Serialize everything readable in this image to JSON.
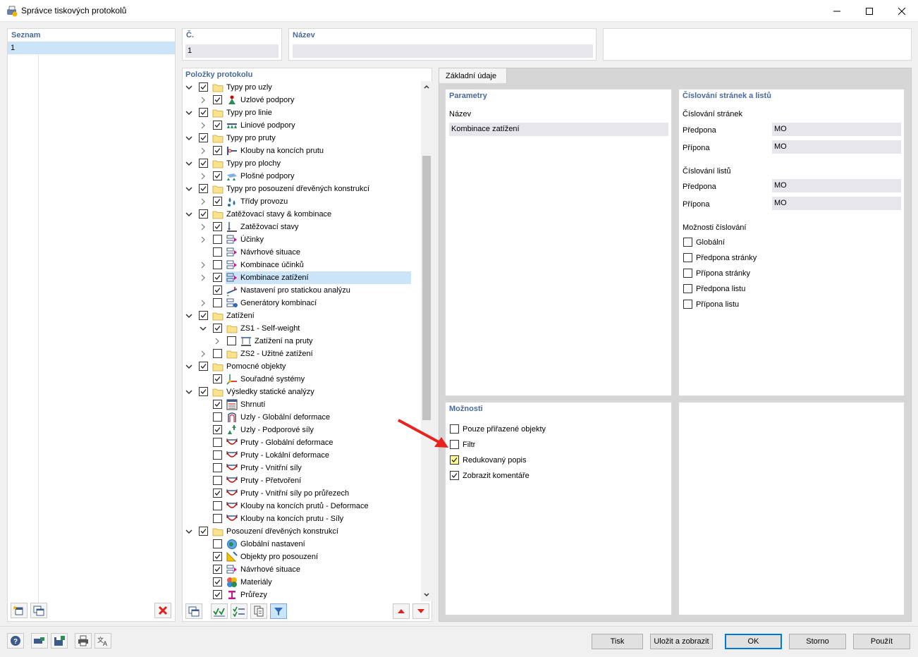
{
  "window": {
    "title": "Správce tiskových protokolů"
  },
  "list_panel": {
    "header": "Seznam",
    "rows": [
      "1"
    ]
  },
  "number_field": {
    "label": "Č.",
    "value": "1"
  },
  "name_field": {
    "label": "Název",
    "value": ""
  },
  "tree": {
    "header": "Položky protokolu",
    "items": [
      {
        "label": "Typy pro uzly",
        "level": 0,
        "expand": "open",
        "checked": true,
        "icon": "folder-icon"
      },
      {
        "label": "Uzlové podpory",
        "level": 1,
        "expand": "closed",
        "checked": true,
        "icon": "nodal-support-icon"
      },
      {
        "label": "Typy pro linie",
        "level": 0,
        "expand": "open",
        "checked": true,
        "icon": "folder-icon"
      },
      {
        "label": "Liniové podpory",
        "level": 1,
        "expand": "closed",
        "checked": true,
        "icon": "line-support-icon"
      },
      {
        "label": "Typy pro pruty",
        "level": 0,
        "expand": "open",
        "checked": true,
        "icon": "folder-icon"
      },
      {
        "label": "Klouby na koncích prutu",
        "level": 1,
        "expand": "closed",
        "checked": true,
        "icon": "member-hinge-icon"
      },
      {
        "label": "Typy pro plochy",
        "level": 0,
        "expand": "open",
        "checked": true,
        "icon": "folder-icon"
      },
      {
        "label": "Plošné podpory",
        "level": 1,
        "expand": "closed",
        "checked": true,
        "icon": "surface-support-icon"
      },
      {
        "label": "Typy pro posouzení dřevěných konstrukcí",
        "level": 0,
        "expand": "open",
        "checked": true,
        "icon": "folder-icon"
      },
      {
        "label": "Třídy provozu",
        "level": 1,
        "expand": "closed",
        "checked": true,
        "icon": "service-class-icon"
      },
      {
        "label": "Zatěžovací stavy & kombinace",
        "level": 0,
        "expand": "open",
        "checked": true,
        "icon": "folder-icon"
      },
      {
        "label": "Zatěžovací stavy",
        "level": 1,
        "expand": "closed",
        "checked": true,
        "icon": "load-case-icon"
      },
      {
        "label": "Účinky",
        "level": 1,
        "expand": "closed",
        "checked": false,
        "icon": "action-icon"
      },
      {
        "label": "Návrhové situace",
        "level": 1,
        "expand": "none",
        "checked": false,
        "icon": "design-situation-icon"
      },
      {
        "label": "Kombinace účinků",
        "level": 1,
        "expand": "closed",
        "checked": false,
        "icon": "action-combination-icon"
      },
      {
        "label": "Kombinace zatížení",
        "level": 1,
        "expand": "closed",
        "checked": true,
        "icon": "load-combination-icon",
        "selected": true
      },
      {
        "label": "Nastavení pro statickou analýzu",
        "level": 1,
        "expand": "none",
        "checked": true,
        "icon": "static-analysis-settings-icon"
      },
      {
        "label": "Generátory kombinací",
        "level": 1,
        "expand": "closed",
        "checked": false,
        "icon": "combination-wizard-icon"
      },
      {
        "label": "Zatížení",
        "level": 0,
        "expand": "open",
        "checked": true,
        "icon": "folder-icon"
      },
      {
        "label": "ZS1 - Self-weight",
        "level": 1,
        "expand": "open",
        "checked": true,
        "icon": "folder-icon"
      },
      {
        "label": "Zatížení na pruty",
        "level": 2,
        "expand": "closed",
        "checked": false,
        "icon": "member-load-icon"
      },
      {
        "label": "ZS2 - Užitné zatížení",
        "level": 1,
        "expand": "closed",
        "checked": false,
        "icon": "folder-icon"
      },
      {
        "label": "Pomocné objekty",
        "level": 0,
        "expand": "open",
        "checked": true,
        "icon": "folder-icon"
      },
      {
        "label": "Souřadné systémy",
        "level": 1,
        "expand": "none",
        "checked": true,
        "icon": "coordinate-system-icon"
      },
      {
        "label": "Výsledky statické analýzy",
        "level": 0,
        "expand": "open",
        "checked": true,
        "icon": "folder-icon"
      },
      {
        "label": "Shrnutí",
        "level": 1,
        "expand": "none",
        "checked": true,
        "icon": "summary-icon"
      },
      {
        "label": "Uzly - Globální deformace",
        "level": 1,
        "expand": "none",
        "checked": false,
        "icon": "node-deformation-icon"
      },
      {
        "label": "Uzly - Podporové síly",
        "level": 1,
        "expand": "none",
        "checked": true,
        "icon": "support-forces-icon"
      },
      {
        "label": "Pruty - Globální deformace",
        "level": 1,
        "expand": "none",
        "checked": false,
        "icon": "member-result-icon"
      },
      {
        "label": "Pruty - Lokální deformace",
        "level": 1,
        "expand": "none",
        "checked": false,
        "icon": "member-result-icon"
      },
      {
        "label": "Pruty - Vnitřní síly",
        "level": 1,
        "expand": "none",
        "checked": false,
        "icon": "member-result-icon"
      },
      {
        "label": "Pruty - Přetvoření",
        "level": 1,
        "expand": "none",
        "checked": false,
        "icon": "member-result-icon"
      },
      {
        "label": "Pruty - Vnitřní síly po průřezech",
        "level": 1,
        "expand": "none",
        "checked": true,
        "icon": "member-result-icon"
      },
      {
        "label": "Klouby na koncích prutů - Deformace",
        "level": 1,
        "expand": "none",
        "checked": false,
        "icon": "member-result-icon"
      },
      {
        "label": "Klouby na koncích prutu - Síly",
        "level": 1,
        "expand": "none",
        "checked": false,
        "icon": "member-result-icon"
      },
      {
        "label": "Posouzení dřevěných konstrukcí",
        "level": 0,
        "expand": "open",
        "checked": true,
        "icon": "folder-icon"
      },
      {
        "label": "Globální nastavení",
        "level": 1,
        "expand": "none",
        "checked": false,
        "icon": "global-settings-icon"
      },
      {
        "label": "Objekty pro posouzení",
        "level": 1,
        "expand": "none",
        "checked": true,
        "icon": "design-objects-icon"
      },
      {
        "label": "Návrhové situace",
        "level": 1,
        "expand": "none",
        "checked": true,
        "icon": "design-situation-icon"
      },
      {
        "label": "Materiály",
        "level": 1,
        "expand": "none",
        "checked": true,
        "icon": "materials-icon"
      },
      {
        "label": "Průřezy",
        "level": 1,
        "expand": "none",
        "checked": true,
        "icon": "cross-section-icon"
      }
    ]
  },
  "tab": {
    "label": "Základní údaje"
  },
  "parameters": {
    "header": "Parametry",
    "name_label": "Název",
    "name_value": "Kombinace zatížení"
  },
  "numbering": {
    "header": "Číslování stránek a listů",
    "pages_label": "Číslování stránek",
    "pages_prefix_label": "Předpona",
    "pages_prefix_value": "MO",
    "pages_suffix_label": "Přípona",
    "pages_suffix_value": "MO",
    "sheets_label": "Číslování listů",
    "sheets_prefix_label": "Předpona",
    "sheets_prefix_value": "MO",
    "sheets_suffix_label": "Přípona",
    "sheets_suffix_value": "MO",
    "options_label": "Možnosti číslování",
    "options": [
      {
        "label": "Globální",
        "checked": false
      },
      {
        "label": "Předpona stránky",
        "checked": false
      },
      {
        "label": "Přípona stránky",
        "checked": false
      },
      {
        "label": "Předpona listu",
        "checked": false
      },
      {
        "label": "Přípona listu",
        "checked": false
      }
    ]
  },
  "options": {
    "header": "Možnosti",
    "items": [
      {
        "label": "Pouze přiřazené objekty",
        "checked": false
      },
      {
        "label": "Filtr",
        "checked": false
      },
      {
        "label": "Redukovaný popis",
        "checked": true,
        "highlight": true
      },
      {
        "label": "Zobrazit komentáře",
        "checked": true
      }
    ]
  },
  "buttons": {
    "print": "Tisk",
    "save_show": "Uložit a zobrazit",
    "ok": "OK",
    "cancel": "Storno",
    "apply": "Použít"
  },
  "colors": {
    "header_blue": "#4a6a9a",
    "selection": "#cce4f7",
    "field_gray": "#e6e6ec",
    "highlight_yellow": "#ffff8c",
    "arrow_red": "#e8231e"
  }
}
